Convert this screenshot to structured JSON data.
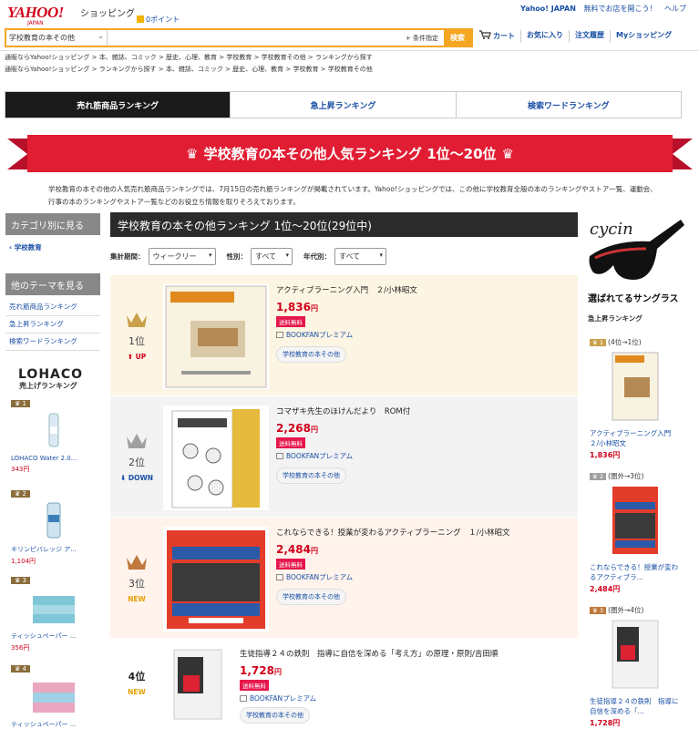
{
  "header": {
    "logo": "YAHOO!",
    "logo_sub": "JAPAN",
    "site": "ショッピング",
    "points": "0ポイント",
    "top_links": [
      "Yahoo! JAPAN",
      "無料でお店を開こう！",
      "ヘルプ"
    ],
    "search_category": "学校教育の本その他",
    "search_placeholder": "",
    "condition_btn": "+ 条件指定",
    "search_btn": "検索",
    "nav": [
      "カート",
      "お気に入り",
      "注文履歴",
      "Myショッピング"
    ]
  },
  "breadcrumbs": [
    {
      "text": "通販ならYahoo!ショッピング > 本、雑誌、コミック > 歴史、心理、教育 > 学校教育 > 学校教育その他 > ランキングから探す"
    },
    {
      "text": "通販ならYahoo!ショッピング > ランキングから探す > 本、雑誌、コミック > 歴史、心理、教育 > 学校教育 > 学校教育その他"
    }
  ],
  "tabs": [
    "売れ筋商品ランキング",
    "急上昇ランキング",
    "検索ワードランキング"
  ],
  "banner": "学校教育の本その他人気ランキング 1位〜20位",
  "intro": "学校教育の本その他の人気売れ筋商品ランキングでは、7月15日の売れ筋ランキングが掲載されています。Yahoo!ショッピングでは、この他に学校教育全般の本のランキングやストア一覧、運動会、行事の本のランキングやストア一覧などのお役立ち情報を取りそろえております。",
  "left_sidebar": {
    "category_head": "カテゴリ別に見る",
    "category_link": "学校教育",
    "theme_head": "他のテーマを見る",
    "theme_links": [
      "売れ筋商品ランキング",
      "急上昇ランキング",
      "検索ワードランキング"
    ],
    "lohaco": "LOHACO",
    "lohaco_sub": "売上げランキング",
    "lohaco_items": [
      {
        "rank": "1",
        "name": "LOHACO Water 2.0...",
        "price": "343円"
      },
      {
        "rank": "2",
        "name": "キリンピバレッジ ア...",
        "price": "1,104円"
      },
      {
        "rank": "3",
        "name": "ティッシュペーパー ...",
        "price": "356円"
      },
      {
        "rank": "4",
        "name": "ティッシュペーパー ...",
        "price": ""
      }
    ]
  },
  "ranking": {
    "head": "学校教育の本その他ランキング 1位〜20位(29位中)",
    "filters": [
      {
        "label": "集計期間：",
        "value": "ウィークリー"
      },
      {
        "label": "性別：",
        "value": "すべて"
      },
      {
        "label": "年代別：",
        "value": "すべて"
      }
    ],
    "items": [
      {
        "rank": "1位",
        "move": "UP",
        "title": "アクティブラーニング入門　２/小林昭文",
        "price": "1,836",
        "yen": "円",
        "ship": "送料無料",
        "store": "BOOKFANプレミアム",
        "tag": "学校教育の本その他"
      },
      {
        "rank": "2位",
        "move": "DOWN",
        "title": "コマザキ先生のほけんだより　ROM付",
        "price": "2,268",
        "yen": "円",
        "ship": "送料無料",
        "store": "BOOKFANプレミアム",
        "tag": "学校教育の本その他"
      },
      {
        "rank": "3位",
        "move": "NEW",
        "title": "これならできる！授業が変わるアクティブラーニング　１/小林昭文",
        "price": "2,484",
        "yen": "円",
        "ship": "送料無料",
        "store": "BOOKFANプレミアム",
        "tag": "学校教育の本その他"
      },
      {
        "rank": "4位",
        "move": "NEW",
        "title": "生徒指導２４の鉄則　指導に自信を深める「考え方」の原理・原則/吉田順",
        "price": "1,728",
        "yen": "円",
        "ship": "送料無料",
        "store": "BOOKFANプレミアム",
        "tag": "学校教育の本その他"
      }
    ]
  },
  "right_sidebar": {
    "ad_brand": "cycin",
    "ad_title": "選ばれてるサングラス",
    "sub": "急上昇ランキング",
    "items": [
      {
        "badge": "1",
        "move": "(4位→1位)",
        "name": "アクティブラーニング入門　２/小林昭文",
        "price": "1,836円"
      },
      {
        "badge": "2",
        "move": "(圏外→3位)",
        "name": "これならできる！授業が変わるアクティブラ...",
        "price": "2,484円"
      },
      {
        "badge": "3",
        "move": "(圏外→4位)",
        "name": "生徒指導２４の鉄則　指導に自信を深める「...",
        "price": "1,728円"
      }
    ]
  },
  "colors": {
    "accent": "#f5a623",
    "red": "#e11d33",
    "link": "#1a4fa5",
    "rank1_bg": "#fdf5e3",
    "rank3_bg": "#fff3ec"
  }
}
